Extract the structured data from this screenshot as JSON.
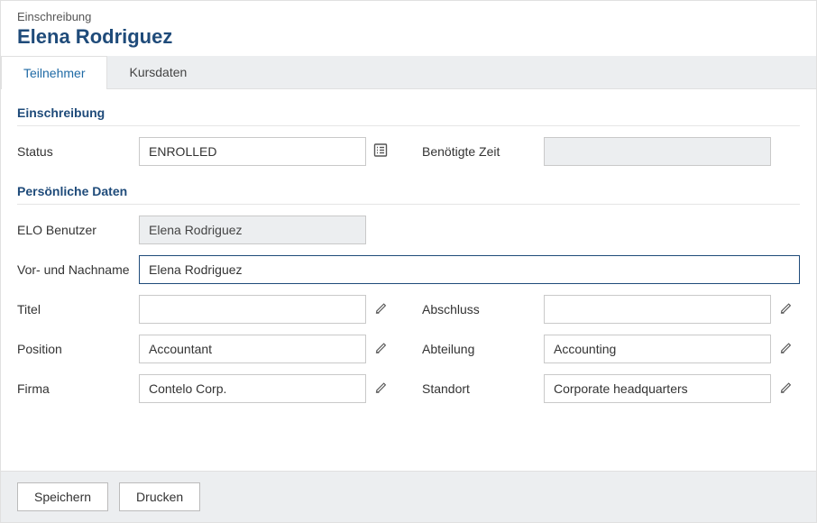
{
  "header": {
    "breadcrumb": "Einschreibung",
    "title": "Elena Rodriguez"
  },
  "tabs": [
    {
      "label": "Teilnehmer",
      "active": true
    },
    {
      "label": "Kursdaten",
      "active": false
    }
  ],
  "sections": {
    "enrollment": {
      "title": "Einschreibung",
      "fields": {
        "status": {
          "label": "Status",
          "value": "ENROLLED"
        },
        "time_required": {
          "label": "Benötigte Zeit",
          "value": ""
        }
      }
    },
    "personal": {
      "title": "Persönliche Daten",
      "fields": {
        "elo_user": {
          "label": "ELO Benutzer",
          "value": "Elena Rodriguez"
        },
        "full_name": {
          "label": "Vor- und Nachname",
          "value": "Elena Rodriguez"
        },
        "title": {
          "label": "Titel",
          "value": ""
        },
        "degree": {
          "label": "Abschluss",
          "value": ""
        },
        "position": {
          "label": "Position",
          "value": "Accountant"
        },
        "department": {
          "label": "Abteilung",
          "value": "Accounting"
        },
        "company": {
          "label": "Firma",
          "value": "Contelo Corp."
        },
        "location": {
          "label": "Standort",
          "value": "Corporate headquarters"
        }
      }
    }
  },
  "footer": {
    "save": "Speichern",
    "print": "Drucken"
  }
}
